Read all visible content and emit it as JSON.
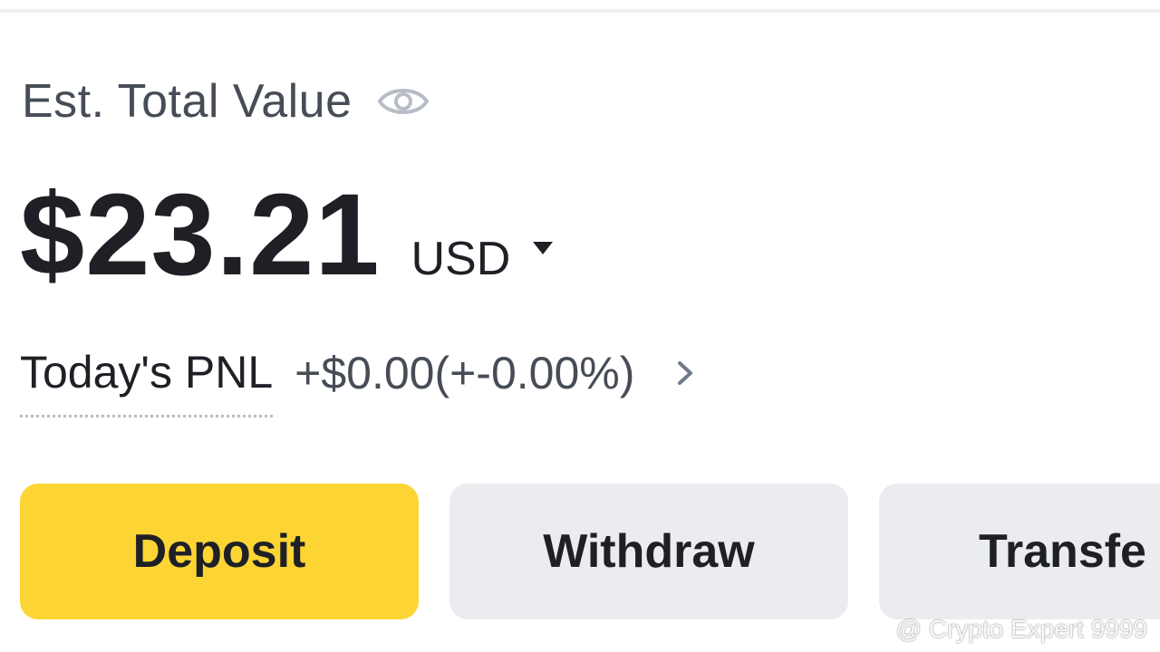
{
  "header": {
    "label": "Est. Total Value"
  },
  "balance": {
    "amount": "$23.21",
    "currency": "USD"
  },
  "pnl": {
    "label": "Today's PNL",
    "value": "+$0.00(+-0.00%)"
  },
  "actions": {
    "deposit_label": "Deposit",
    "withdraw_label": "Withdraw",
    "transfer_label": "Transfe"
  },
  "watermark": {
    "text": "@ Crypto Expert 9999"
  },
  "colors": {
    "accent": "#fcd535",
    "secondary_button": "#eaecef",
    "text_primary": "#1e2026",
    "text_secondary": "#474d57"
  },
  "icons": {
    "visibility": "eye-icon",
    "currency_dropdown": "caret-down-icon",
    "pnl_details": "chevron-right-icon",
    "watermark_logo": "binance-logo-icon"
  }
}
